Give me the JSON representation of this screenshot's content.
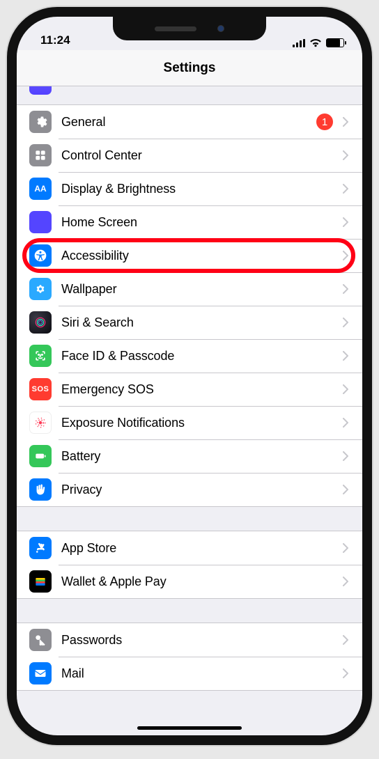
{
  "status": {
    "time": "11:24"
  },
  "header": {
    "title": "Settings"
  },
  "groups": [
    {
      "items": [
        {
          "id": "general",
          "label": "General",
          "badge": "1"
        },
        {
          "id": "control-center",
          "label": "Control Center"
        },
        {
          "id": "display",
          "label": "Display & Brightness"
        },
        {
          "id": "home-screen",
          "label": "Home Screen"
        },
        {
          "id": "accessibility",
          "label": "Accessibility",
          "highlighted": true
        },
        {
          "id": "wallpaper",
          "label": "Wallpaper"
        },
        {
          "id": "siri",
          "label": "Siri & Search"
        },
        {
          "id": "faceid",
          "label": "Face ID & Passcode"
        },
        {
          "id": "sos",
          "label": "Emergency SOS"
        },
        {
          "id": "exposure",
          "label": "Exposure Notifications"
        },
        {
          "id": "battery",
          "label": "Battery"
        },
        {
          "id": "privacy",
          "label": "Privacy"
        }
      ]
    },
    {
      "items": [
        {
          "id": "appstore",
          "label": "App Store"
        },
        {
          "id": "wallet",
          "label": "Wallet & Apple Pay"
        }
      ]
    },
    {
      "items": [
        {
          "id": "passwords",
          "label": "Passwords"
        },
        {
          "id": "mail",
          "label": "Mail"
        }
      ]
    }
  ]
}
